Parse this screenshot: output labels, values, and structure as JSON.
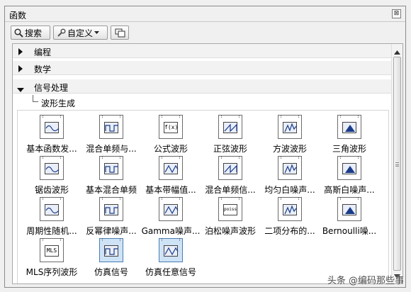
{
  "window": {
    "title": "函数",
    "close_glyph": "⊠"
  },
  "toolbar": {
    "search_label": "搜索",
    "customize_label": "自定义"
  },
  "categories": [
    {
      "label": "编程",
      "expanded": false
    },
    {
      "label": "数学",
      "expanded": false
    },
    {
      "label": "信号处理",
      "expanded": true
    }
  ],
  "subcategory": {
    "label": "波形生成"
  },
  "functions": [
    {
      "name": "基本函数发...",
      "icon": "basic-function-generator-icon"
    },
    {
      "name": "混合单频与...",
      "icon": "mixed-single-tone-icon"
    },
    {
      "name": "公式波形",
      "icon": "formula-waveform-icon",
      "badge": "f(x)"
    },
    {
      "name": "正弦波形",
      "icon": "sine-waveform-icon"
    },
    {
      "name": "方波波形",
      "icon": "square-waveform-icon"
    },
    {
      "name": "三角波形",
      "icon": "triangle-waveform-icon"
    },
    {
      "name": "锯齿波形",
      "icon": "sawtooth-waveform-icon"
    },
    {
      "name": "基本混合单频",
      "icon": "basic-multitone-icon"
    },
    {
      "name": "基本带幅值...",
      "icon": "basic-multitone-amplitude-icon"
    },
    {
      "name": "混合单频信...",
      "icon": "multitone-signal-icon"
    },
    {
      "name": "均匀白噪声...",
      "icon": "uniform-white-noise-icon"
    },
    {
      "name": "高斯白噪声...",
      "icon": "gaussian-white-noise-icon"
    },
    {
      "name": "周期性随机...",
      "icon": "periodic-random-noise-icon"
    },
    {
      "name": "反幂律噪声...",
      "icon": "inverse-power-noise-icon"
    },
    {
      "name": "Gamma噪声...",
      "icon": "gamma-noise-icon"
    },
    {
      "name": "泊松噪声波形",
      "icon": "poisson-noise-icon",
      "badge": "poisson"
    },
    {
      "name": "二项分布的...",
      "icon": "binomial-noise-icon"
    },
    {
      "name": "Bernoulli噪...",
      "icon": "bernoulli-noise-icon"
    },
    {
      "name": "MLS序列波形",
      "icon": "mls-sequence-icon",
      "badge": "MLS"
    },
    {
      "name": "仿真信号",
      "icon": "simulate-signal-icon",
      "selected": true
    },
    {
      "name": "仿真任意信号",
      "icon": "simulate-arbitrary-signal-icon",
      "selected": true
    }
  ],
  "watermark": "头条 @编码那些事"
}
